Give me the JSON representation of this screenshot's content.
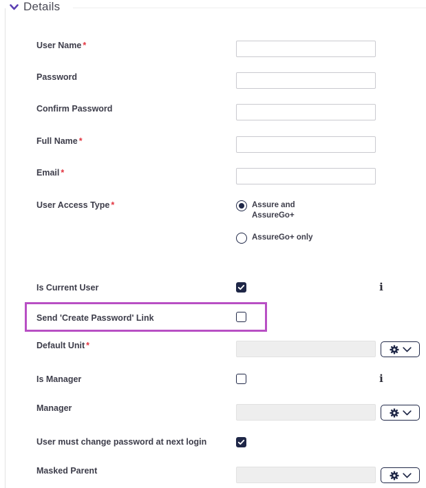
{
  "section": {
    "title": "Details"
  },
  "fields": {
    "user_name": {
      "label": "User Name",
      "required_mark": "*",
      "value": ""
    },
    "password": {
      "label": "Password",
      "value": ""
    },
    "confirm_password": {
      "label": "Confirm Password",
      "value": ""
    },
    "full_name": {
      "label": "Full Name",
      "required_mark": "*",
      "value": ""
    },
    "email": {
      "label": "Email",
      "required_mark": "*",
      "value": ""
    },
    "user_access_type": {
      "label": "User Access Type",
      "required_mark": "*",
      "options": [
        {
          "label": "Assure and AssureGo+",
          "selected": true
        },
        {
          "label": "AssureGo+ only",
          "selected": false
        }
      ]
    },
    "is_current_user": {
      "label": "Is Current User",
      "checked": true
    },
    "send_create_password_link": {
      "label": "Send 'Create Password' Link",
      "checked": false
    },
    "default_unit": {
      "label": "Default Unit",
      "required_mark": "*",
      "value": ""
    },
    "is_manager": {
      "label": "Is Manager",
      "checked": false
    },
    "manager": {
      "label": "Manager",
      "value": ""
    },
    "must_change_password": {
      "label": "User must change password at next login",
      "checked": true
    },
    "masked_parent": {
      "label": "Masked Parent",
      "value": ""
    }
  },
  "icons": {
    "section_toggle": "chevron-down-icon",
    "info": "info-icon",
    "lookup_settings": "gear-icon",
    "lookup_dropdown": "chevron-down-icon"
  },
  "colors": {
    "accent": "#5b3fb3",
    "control_dark": "#1f2747",
    "required": "#e2343f",
    "highlight": "#b84fc4",
    "disabled_fill": "#eeeeee"
  }
}
